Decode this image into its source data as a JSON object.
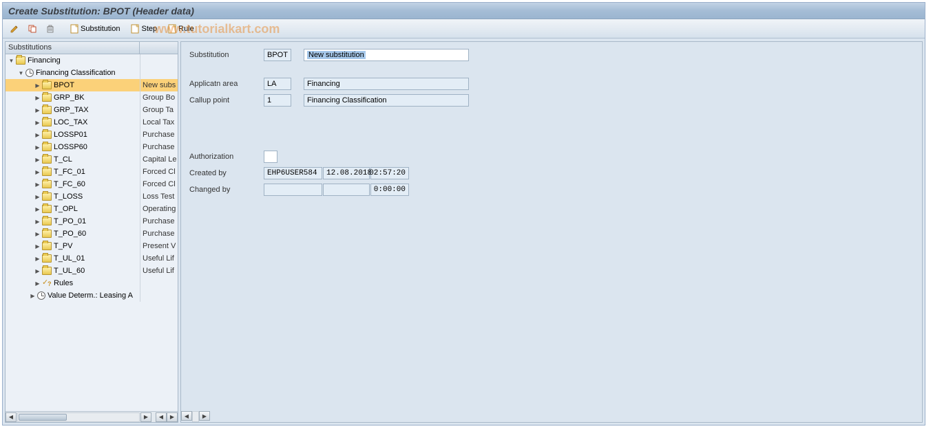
{
  "title": "Create Substitution: BPOT (Header data)",
  "watermark": "www.tutorialkart.com",
  "toolbar": {
    "substitution_btn": "Substitution",
    "step_btn": "Step",
    "rule_btn": "Rule"
  },
  "tree": {
    "header": "Substitutions",
    "root": {
      "label": "Financing"
    },
    "class_node": {
      "label": "Financing Classification"
    },
    "items": [
      {
        "code": "BPOT",
        "desc": "New subs"
      },
      {
        "code": "GRP_BK",
        "desc": "Group Bo"
      },
      {
        "code": "GRP_TAX",
        "desc": "Group Ta"
      },
      {
        "code": "LOC_TAX",
        "desc": "Local Tax"
      },
      {
        "code": "LOSSP01",
        "desc": "Purchase"
      },
      {
        "code": "LOSSP60",
        "desc": "Purchase"
      },
      {
        "code": "T_CL",
        "desc": "Capital Le"
      },
      {
        "code": "T_FC_01",
        "desc": "Forced Cl"
      },
      {
        "code": "T_FC_60",
        "desc": "Forced Cl"
      },
      {
        "code": "T_LOSS",
        "desc": "Loss Test"
      },
      {
        "code": "T_OPL",
        "desc": "Operating"
      },
      {
        "code": "T_PO_01",
        "desc": "Purchase"
      },
      {
        "code": "T_PO_60",
        "desc": "Purchase"
      },
      {
        "code": "T_PV",
        "desc": "Present V"
      },
      {
        "code": "T_UL_01",
        "desc": "Useful Lif"
      },
      {
        "code": "T_UL_60",
        "desc": "Useful Lif"
      }
    ],
    "rules_node": "Rules",
    "value_determ": "Value Determ.: Leasing A"
  },
  "form": {
    "substitution_label": "Substitution",
    "substitution_code": "BPOT",
    "substitution_name": "New substitution",
    "app_area_label": "Applicatn area",
    "app_area_code": "LA",
    "app_area_name": "Financing",
    "callup_label": "Callup point",
    "callup_code": "1",
    "callup_name": "Financing Classification",
    "auth_label": "Authorization",
    "auth_value": "",
    "created_label": "Created by",
    "created_user": "EHP6USER584",
    "created_date": "12.08.2018",
    "created_time": "02:57:20",
    "changed_label": "Changed by",
    "changed_user": "",
    "changed_date": "",
    "changed_time": "0:00:00"
  }
}
